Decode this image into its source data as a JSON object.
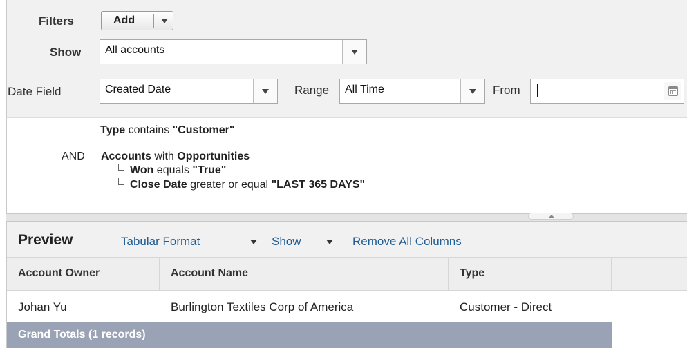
{
  "filters": {
    "filters_label": "Filters",
    "add_label": "Add",
    "show_label": "Show",
    "show_value": "All accounts",
    "date_field_label": "Date Field",
    "date_field_value": "Created Date",
    "range_label": "Range",
    "range_value": "All Time",
    "from_label": "From",
    "from_value": ""
  },
  "logic": {
    "line1_field": "Type",
    "line1_rest": " contains ",
    "line1_value": "\"Customer\"",
    "and_label": "AND",
    "line2_field": "Accounts",
    "line2_mid": " with ",
    "line2_rel": "Opportunities",
    "sub1_field": "Won",
    "sub1_op": " equals ",
    "sub1_value": "\"True\"",
    "sub2_field": "Close Date",
    "sub2_op": " greater or equal ",
    "sub2_value": "\"LAST 365 DAYS\""
  },
  "preview": {
    "title": "Preview",
    "format_label": "Tabular Format",
    "show_label": "Show",
    "remove_label": "Remove All Columns"
  },
  "table": {
    "columns": [
      "Account Owner",
      "Account Name",
      "Type"
    ],
    "rows": [
      [
        "Johan Yu",
        "Burlington Textiles Corp of America",
        "Customer - Direct"
      ]
    ],
    "grand_totals": "Grand Totals (1 records)"
  },
  "colors": {
    "panel_bg": "#f1f1f1",
    "link": "#1f5d94",
    "totals_bg": "#99a3b5"
  },
  "icons": [
    "dropdown-arrow-icon",
    "calendar-icon",
    "tree-branch-icon",
    "splitter-up-icon"
  ]
}
